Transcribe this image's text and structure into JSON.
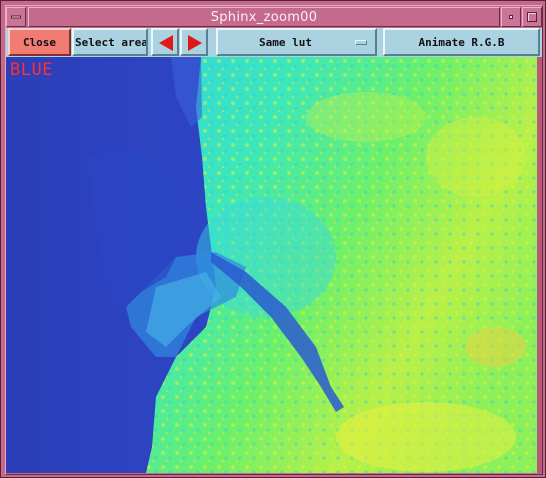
{
  "window": {
    "title": "Sphinx_zoom00"
  },
  "toolbar": {
    "close_label": "Close",
    "select_area_label": "Select area",
    "lut_selected": "Same lut",
    "animate_label": "Animate R.G.B"
  },
  "viewer": {
    "channel_label": "BLUE"
  },
  "colors": {
    "title_bar": "#c46a8c",
    "toolbar": "#aad2e0",
    "close_button": "#f07c74",
    "arrow": "#e01818",
    "channel_label": "#ff3030",
    "water": "#2944c8",
    "land_cyan": "#33ddd8",
    "land_green": "#5cf07a",
    "land_yellow": "#d8f040"
  },
  "icons": {
    "prev": "left-arrow-icon",
    "next": "right-arrow-icon",
    "menu": "window-menu-icon",
    "minimize": "minimize-icon",
    "maximize": "maximize-icon",
    "dropdown": "dropdown-indicator-icon"
  }
}
